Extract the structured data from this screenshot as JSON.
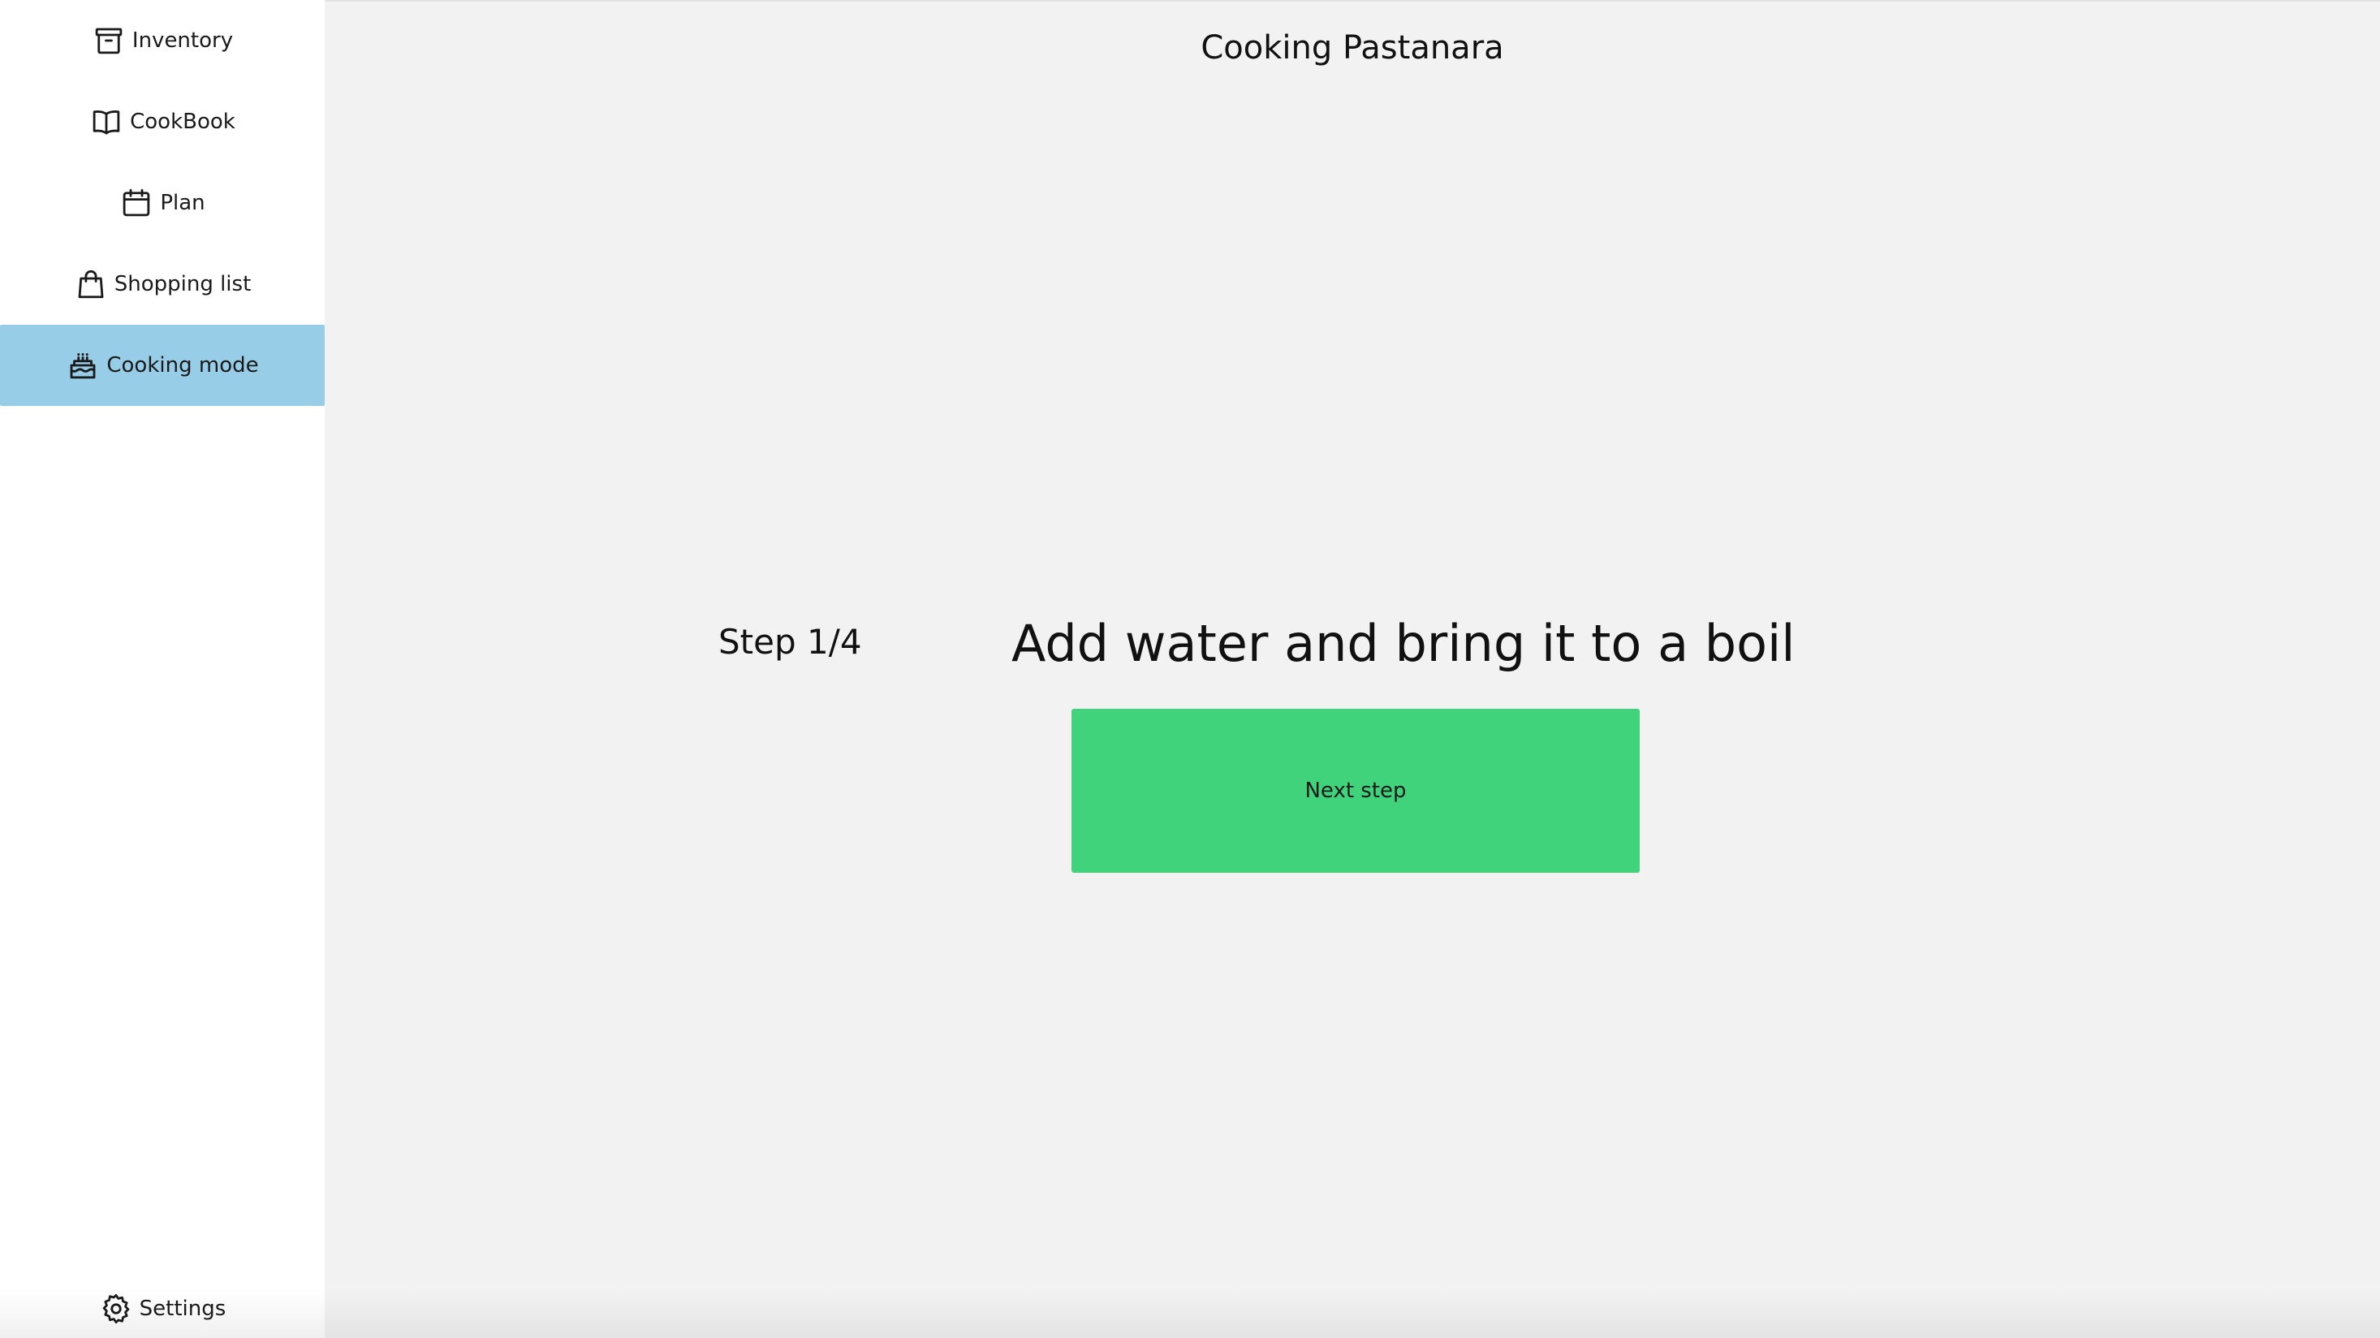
{
  "sidebar": {
    "items": [
      {
        "label": "Inventory",
        "icon": "archive-box-icon",
        "active": false
      },
      {
        "label": "CookBook",
        "icon": "open-book-icon",
        "active": false
      },
      {
        "label": "Plan",
        "icon": "calendar-icon",
        "active": false
      },
      {
        "label": "Shopping list",
        "icon": "shopping-bag-icon",
        "active": false
      },
      {
        "label": "Cooking mode",
        "icon": "cake-icon",
        "active": true
      }
    ],
    "settings": {
      "label": "Settings",
      "icon": "gear-icon"
    }
  },
  "main": {
    "title": "Cooking Pastanara",
    "step_counter": "Step 1/4",
    "step_text": "Add water and bring it to a boil",
    "next_button_label": "Next step"
  },
  "colors": {
    "active_nav": "#98cde7",
    "next_button": "#41d27c",
    "main_background": "#f2f2f2",
    "sidebar_background": "#ffffff"
  }
}
